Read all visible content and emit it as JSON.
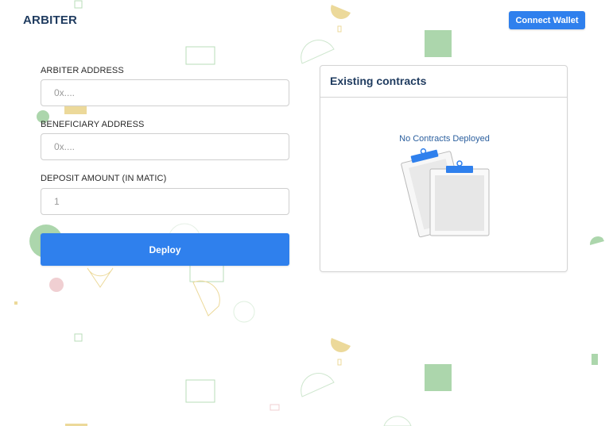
{
  "app": {
    "brand": "ARBITER"
  },
  "header": {
    "connect_label": "Connect Wallet"
  },
  "form": {
    "arbiter": {
      "label": "ARBITER ADDRESS",
      "placeholder": "0x...."
    },
    "beneficiary": {
      "label": "BENEFICIARY ADDRESS",
      "placeholder": "0x...."
    },
    "deposit": {
      "label": "DEPOSIT AMOUNT (IN MATIC)",
      "placeholder": "1"
    },
    "deploy_label": "Deploy"
  },
  "contracts": {
    "title": "Existing contracts",
    "empty_text": "No Contracts Deployed",
    "empty_icon": "clipboard-icon"
  },
  "colors": {
    "accent": "#2f80ed",
    "brand_text": "#1f3b5f",
    "shape_green": "#a9d5a9",
    "shape_yellow": "#ecd99a",
    "shape_pink": "#f0cfd2"
  }
}
